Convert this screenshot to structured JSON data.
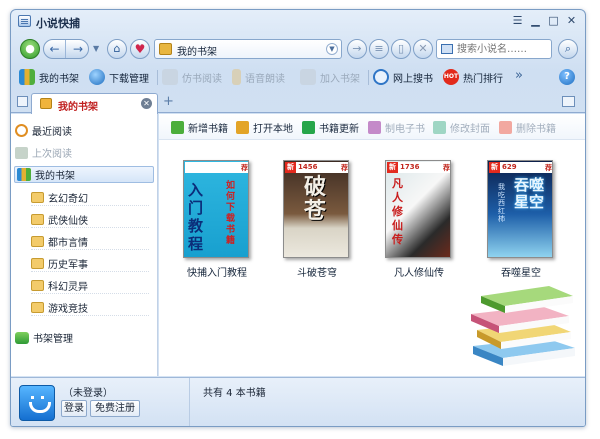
{
  "window": {
    "title": "小说快捕"
  },
  "nav": {
    "address": "我的书架",
    "search_placeholder": "搜索小说名……"
  },
  "toolbar": {
    "items": [
      {
        "label": "我的书架",
        "enabled": true
      },
      {
        "label": "下载管理",
        "enabled": true
      },
      {
        "label": "仿书阅读",
        "enabled": false
      },
      {
        "label": "语音朗读",
        "enabled": false
      },
      {
        "label": "加入书架",
        "enabled": false
      },
      {
        "label": "网上搜书",
        "enabled": true
      },
      {
        "label": "热门排行",
        "enabled": true
      }
    ],
    "hot_badge": "HOT",
    "more": "»",
    "help": "?"
  },
  "tab": {
    "label": "我的书架"
  },
  "sidebar": {
    "recent": "最近阅读",
    "last": "上次阅读",
    "shelf": "我的书架",
    "categories": [
      "玄幻奇幻",
      "武侠仙侠",
      "都市言情",
      "历史军事",
      "科幻灵异",
      "游戏竞技"
    ],
    "manage": "书架管理"
  },
  "shelf_toolbar": {
    "items": [
      {
        "label": "新增书籍",
        "enabled": true,
        "color": "#4cae3b"
      },
      {
        "label": "打开本地",
        "enabled": true,
        "color": "#e3a427"
      },
      {
        "label": "书籍更新",
        "enabled": true,
        "color": "#27a64a"
      },
      {
        "label": "制电子书",
        "enabled": false,
        "color": "#c48ac9"
      },
      {
        "label": "修改封面",
        "enabled": false,
        "color": "#9fd6c4"
      },
      {
        "label": "删除书籍",
        "enabled": false,
        "color": "#f2a8a0"
      }
    ]
  },
  "books": [
    {
      "title": "快捕入门教程",
      "cover_text": "入门教程",
      "cover_sub": "如何下载书籍",
      "badge_num": "",
      "badge_new": "",
      "badge_upd": "荐"
    },
    {
      "title": "斗破苍穹",
      "cover_text": "破苍",
      "cover_sub": "",
      "badge_num": "1456",
      "badge_new": "新",
      "badge_upd": "荐"
    },
    {
      "title": "凡人修仙传",
      "cover_text": "凡人修仙传",
      "cover_sub": "",
      "badge_num": "1736",
      "badge_new": "新",
      "badge_upd": "荐"
    },
    {
      "title": "吞噬星空",
      "cover_text": "吞噬星空",
      "cover_sub": "我吃西红柿",
      "badge_num": "629",
      "badge_new": "新",
      "badge_upd": "荐"
    }
  ],
  "footer": {
    "user": "（未登录）",
    "login": "登录",
    "register": "免费注册",
    "count_text": "共有 4 本书籍"
  },
  "colors": {
    "accent": "#2f6fb6",
    "tab_label": "#c02020"
  }
}
